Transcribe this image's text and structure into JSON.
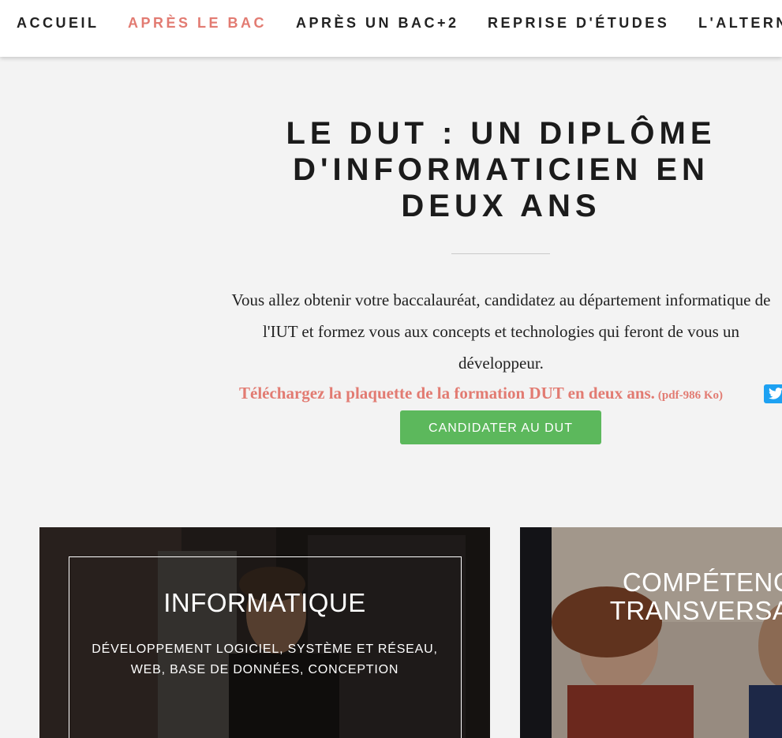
{
  "nav": {
    "items": [
      {
        "label": "ACCUEIL",
        "active": false
      },
      {
        "label": "APRÈS LE BAC",
        "active": true
      },
      {
        "label": "APRÈS UN BAC+2",
        "active": false
      },
      {
        "label": "REPRISE D'ÉTUDES",
        "active": false
      },
      {
        "label": "L'ALTERNANCE",
        "active": false
      }
    ]
  },
  "hero": {
    "title": "LE DUT : UN DIPLÔME D'INFORMATICIEN EN DEUX ANS",
    "intro": "Vous allez obtenir votre baccalauréat, candidatez au département informatique de l'IUT et formez vous aux concepts et technologies qui feront de vous un développeur.",
    "download_label": "Téléchargez la plaquette de la formation DUT en deux ans.",
    "download_meta": "(pdf-986 Ko)",
    "cta_label": "CANDIDATER AU DUT"
  },
  "cards": [
    {
      "title": "INFORMATIQUE",
      "subtitle": "DÉVELOPPEMENT LOGICIEL, SYSTÈME ET RÉSEAU, WEB, BASE DE DONNÉES, CONCEPTION"
    },
    {
      "title": "COMPÉTENCES TRANSVERSALES",
      "subtitle": ""
    }
  ],
  "icons": {
    "share": "twitter-icon"
  },
  "colors": {
    "accent": "#e27b72",
    "cta": "#5cb85c",
    "twitter": "#1da1f2",
    "text": "#1b1b1b",
    "background": "#f3f3f3"
  }
}
